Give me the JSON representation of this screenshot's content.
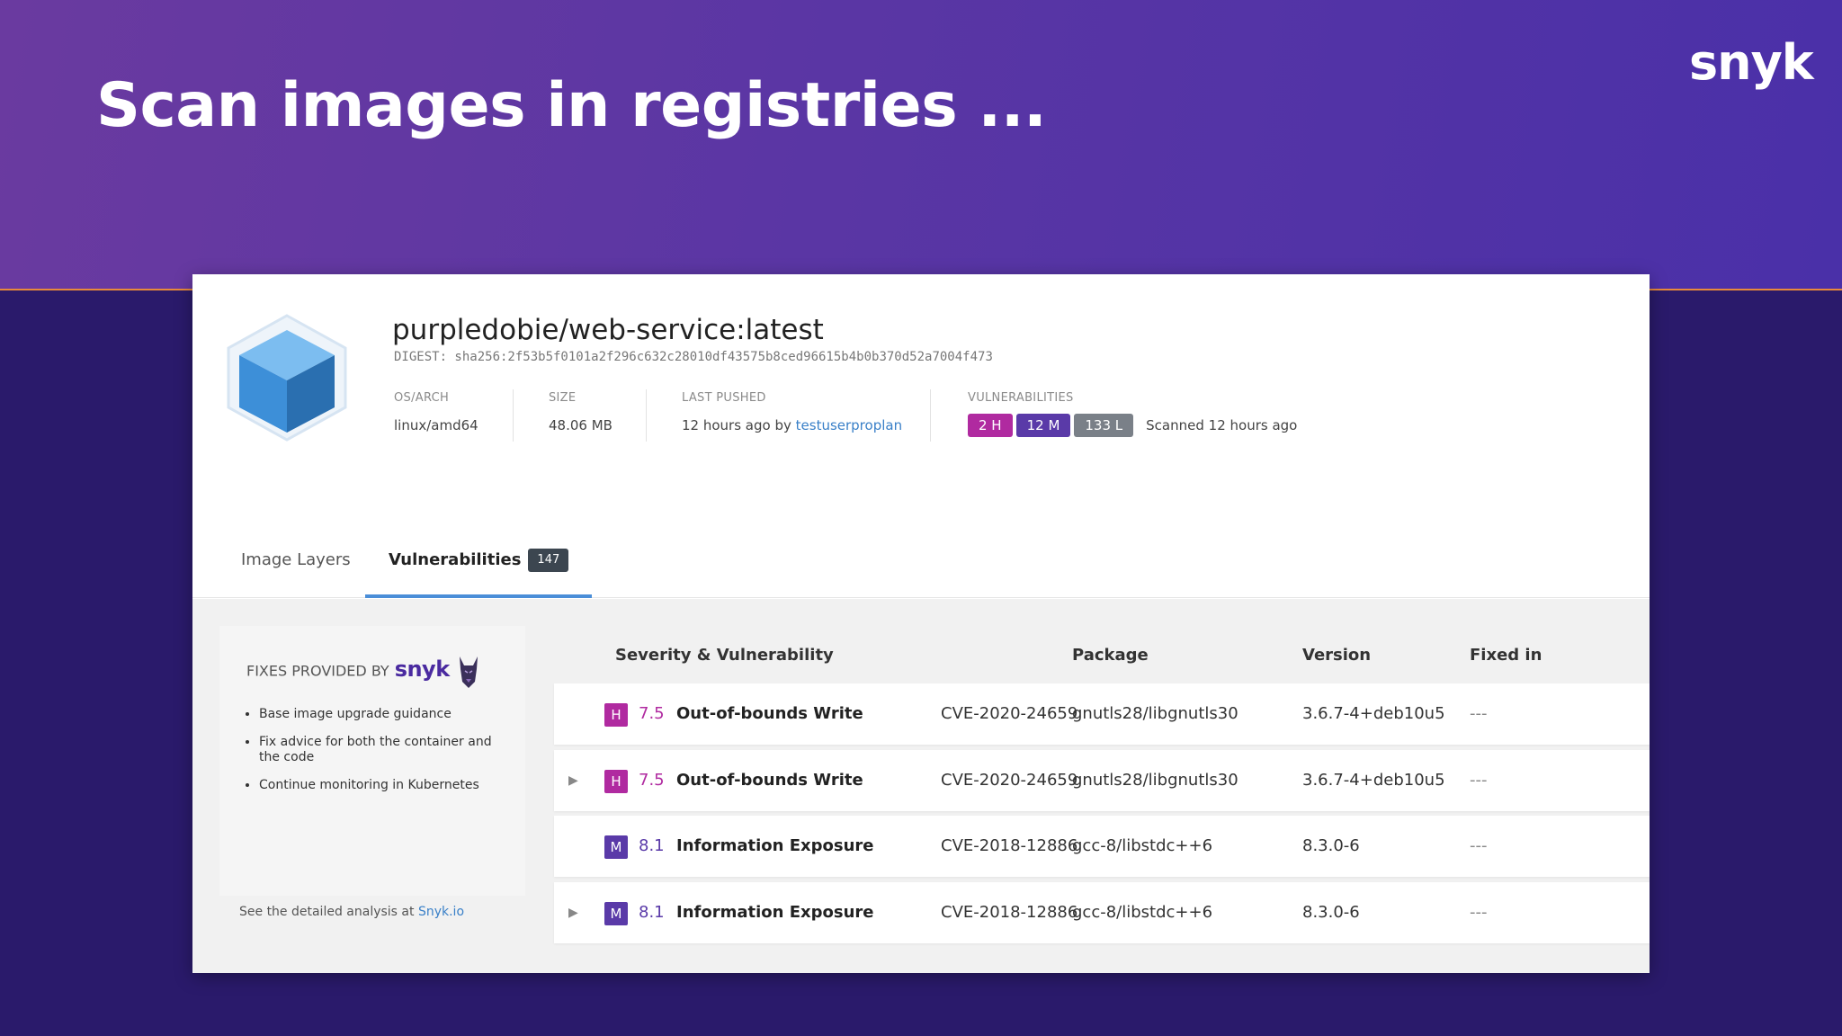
{
  "slide": {
    "title": "Scan images in registries ...",
    "brand": "snyk"
  },
  "image": {
    "name": "purpledobie/web-service:latest",
    "digest": "DIGEST: sha256:2f53b5f0101a2f296c632c28010df43575b8ced96615b4b0b370d52a7004f473",
    "os_arch_label": "OS/ARCH",
    "os_arch": "linux/amd64",
    "size_label": "SIZE",
    "size": "48.06 MB",
    "last_pushed_label": "LAST PUSHED",
    "last_pushed_prefix": "12 hours ago by",
    "last_pushed_user": "testuserproplan",
    "vulns_label": "VULNERABILITIES",
    "high": "2 H",
    "medium": "12 M",
    "low": "133 L",
    "scanned": "Scanned 12 hours ago"
  },
  "tabs": [
    {
      "label": "Image Layers"
    },
    {
      "label": "Vulnerabilities",
      "count": "147"
    }
  ],
  "fixes": {
    "title": "FIXES PROVIDED BY",
    "brand": "snyk",
    "items": [
      "Base image upgrade guidance",
      "Fix advice for both the container and the code",
      "Continue monitoring in Kubernetes"
    ],
    "footer_prefix": "See the detailed analysis at",
    "footer_link": "Snyk.io"
  },
  "table": {
    "headers": {
      "severity": "Severity & Vulnerability",
      "package": "Package",
      "version": "Version",
      "fixed": "Fixed in"
    },
    "rows": [
      {
        "sev": "H",
        "score": "7.5",
        "title": "Out-of-bounds Write",
        "cve": "CVE-2020-24659",
        "package": "gnutls28/libgnutls30",
        "version": "3.6.7-4+deb10u5",
        "fixed": "---",
        "expandable": false
      },
      {
        "sev": "H",
        "score": "7.5",
        "title": "Out-of-bounds Write",
        "cve": "CVE-2020-24659",
        "package": "gnutls28/libgnutls30",
        "version": "3.6.7-4+deb10u5",
        "fixed": "---",
        "expandable": true
      },
      {
        "sev": "M",
        "score": "8.1",
        "title": "Information Exposure",
        "cve": "CVE-2018-12886",
        "package": "gcc-8/libstdc++6",
        "version": "8.3.0-6",
        "fixed": "---",
        "expandable": false
      },
      {
        "sev": "M",
        "score": "8.1",
        "title": "Information Exposure",
        "cve": "CVE-2018-12886",
        "package": "gcc-8/libstdc++6",
        "version": "8.3.0-6",
        "fixed": "---",
        "expandable": true
      }
    ]
  },
  "colors": {
    "high": "#b02aa0",
    "medium": "#5a3aa8",
    "low": "#7a8088",
    "link": "#3a80c8",
    "tab_underline": "#4a8ed8"
  }
}
